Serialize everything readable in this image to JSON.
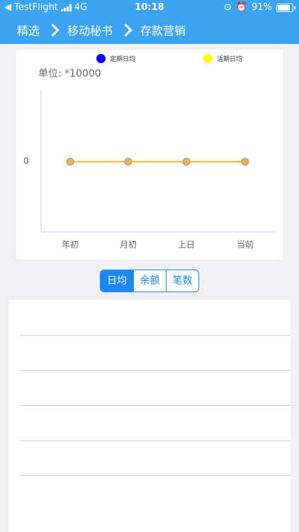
{
  "status": {
    "back_app": "TestFlight",
    "network": "4G",
    "time": "10:18",
    "battery": "91%"
  },
  "nav": {
    "crumbs": [
      "精选",
      "移动秘书",
      "存款营销"
    ]
  },
  "chart_data": {
    "type": "line",
    "unit_label": "单位: *10000",
    "categories": [
      "年初",
      "月初",
      "上日",
      "当前"
    ],
    "y_tick": "0",
    "series": [
      {
        "name": "定期日均",
        "color": "#0000ee",
        "values": [
          0,
          0,
          0,
          0
        ]
      },
      {
        "name": "活期日均",
        "color": "#ffff00",
        "values": [
          0,
          0,
          0,
          0
        ]
      }
    ],
    "line_color": "#f5b82e",
    "marker_fill": "#f0b24a",
    "marker_stroke": "#8a96a8"
  },
  "segments": {
    "items": [
      "日均",
      "余额",
      "笔数"
    ],
    "selected_index": 0
  },
  "table": {
    "rows": [
      {
        "cells": []
      },
      {
        "cells": []
      },
      {
        "cells": []
      },
      {
        "cells": []
      },
      {
        "cells": []
      },
      {
        "cells": []
      }
    ]
  }
}
